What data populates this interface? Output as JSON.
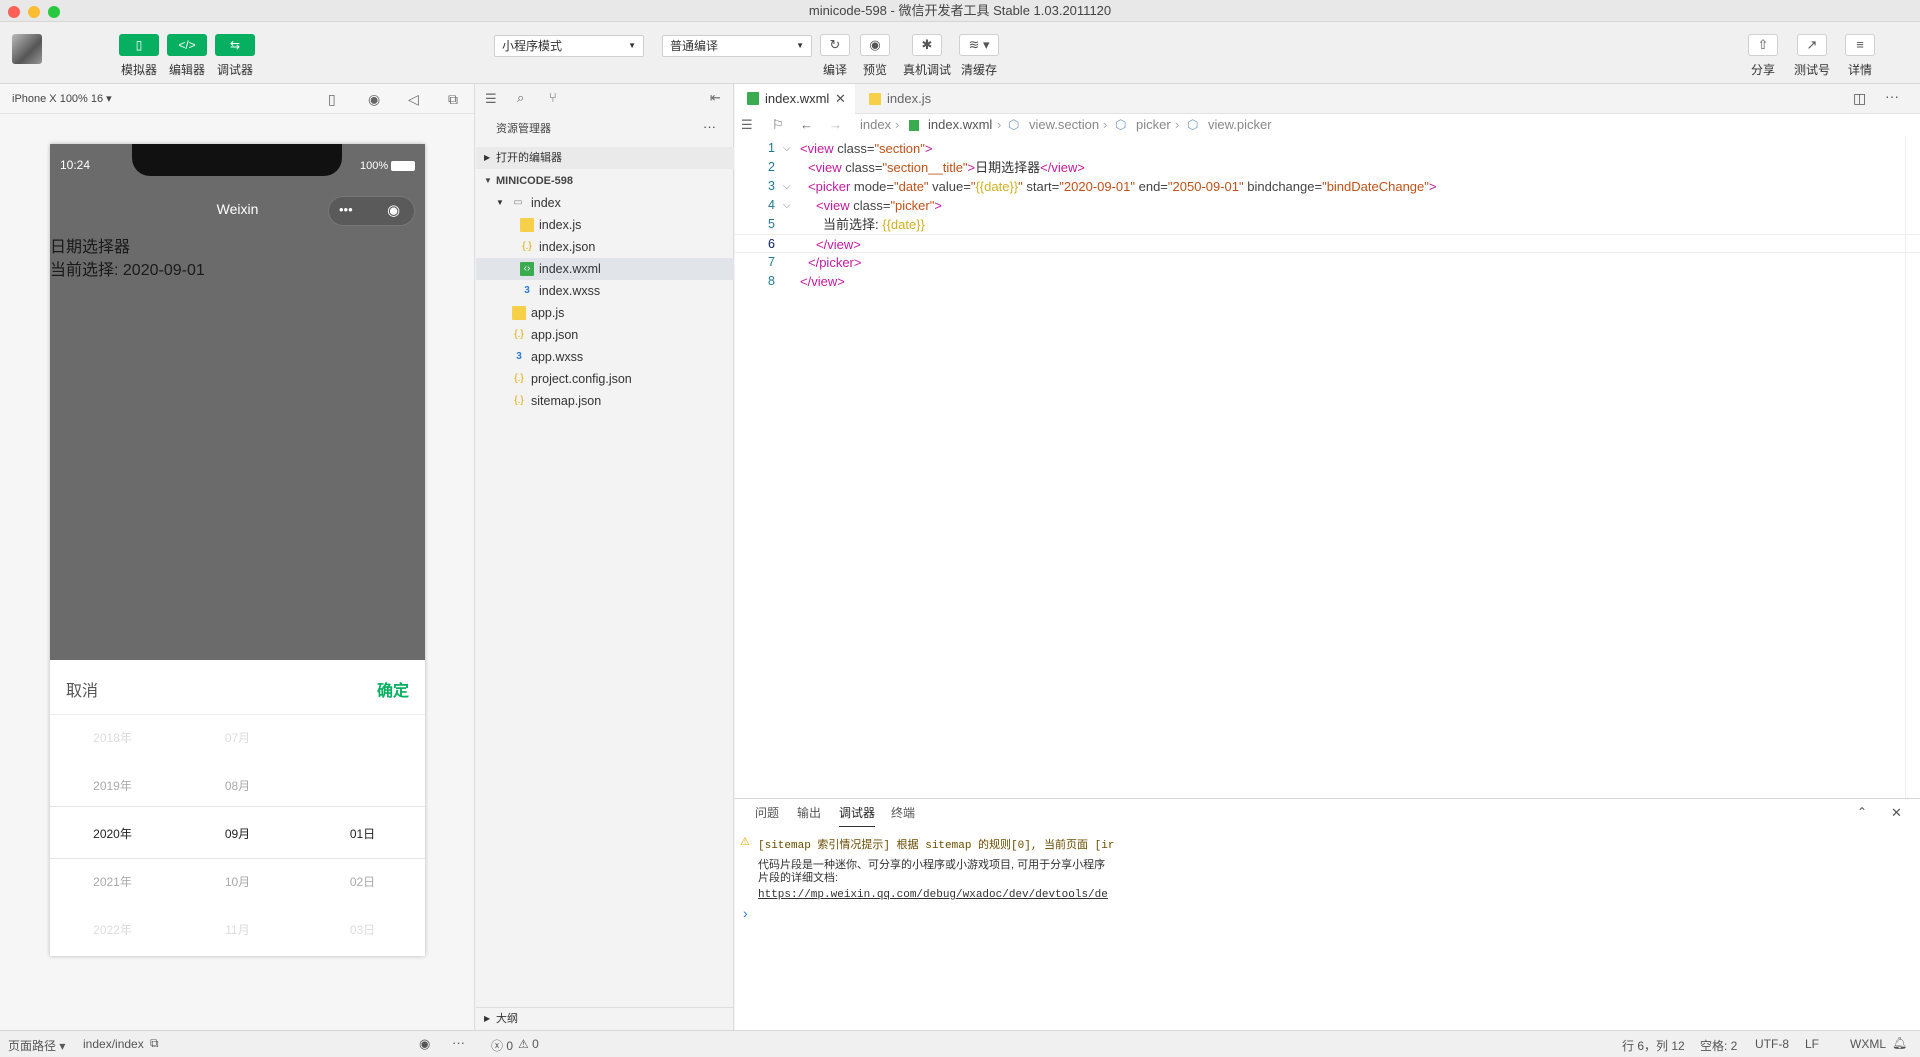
{
  "window": {
    "title": "minicode-598 - 微信开发者工具 Stable 1.03.2011120"
  },
  "toolbar": {
    "avatar_label": "avatar",
    "simulator": "模拟器",
    "editor": "编辑器",
    "debugger": "调试器",
    "mode_select": "小程序模式",
    "compile_select": "普通编译",
    "compile": "编译",
    "preview": "预览",
    "real_debug": "真机调试",
    "clear_cache": "清缓存",
    "share": "分享",
    "test_account": "测试号",
    "details": "详情"
  },
  "simulator": {
    "device": "iPhone X 100% 16 ▾",
    "time": "10:24",
    "battery": "100%",
    "nav_title": "Weixin",
    "page_title": "日期选择器",
    "current": "当前选择: 2020-09-01",
    "picker": {
      "cancel": "取消",
      "confirm": "确定",
      "years": [
        "2018年",
        "2019年",
        "2020年",
        "2021年",
        "2022年"
      ],
      "months": [
        "07月",
        "08月",
        "09月",
        "10月",
        "11月"
      ],
      "days": [
        "",
        "",
        "01日",
        "02日",
        "03日"
      ]
    }
  },
  "explorer": {
    "header": "资源管理器",
    "open_editors": "打开的编辑器",
    "project": "MINICODE-598",
    "folder_index": "index",
    "files_index": [
      "index.js",
      "index.json",
      "index.wxml",
      "index.wxss"
    ],
    "files_root": [
      "app.js",
      "app.json",
      "app.wxss",
      "project.config.json",
      "sitemap.json"
    ],
    "outline": "大纲"
  },
  "editor": {
    "tabs": [
      "index.wxml",
      "index.js"
    ],
    "crumbs": [
      "index",
      "index.wxml",
      "view.section",
      "picker",
      "view.picker"
    ],
    "line_numbers": [
      "1",
      "2",
      "3",
      "4",
      "5",
      "6",
      "7",
      "8"
    ],
    "code": {
      "l1": [
        "<view",
        " class=",
        "\"section\"",
        ">"
      ],
      "l2": [
        "<view",
        " class=",
        "\"section__title\"",
        ">",
        "日期选择器",
        "</view>"
      ],
      "l3": [
        "<picker",
        " mode=",
        "\"date\"",
        " value=",
        "\"",
        "{{date}}",
        "\"",
        " start=",
        "\"2020-09-01\"",
        " end=",
        "\"2050-09-01\"",
        " bindchange=",
        "\"bindDateChange\"",
        ">"
      ],
      "l4": [
        "<view",
        " class=",
        "\"picker\"",
        ">"
      ],
      "l5": [
        "当前选择: ",
        "{{date}}"
      ],
      "l6": [
        "</view>"
      ],
      "l7": [
        "</picker>"
      ],
      "l8": [
        "</view>"
      ]
    }
  },
  "console": {
    "tabs": [
      "问题",
      "输出",
      "调试器",
      "终端"
    ],
    "warn": "[sitemap 索引情况提示] 根据 sitemap 的规则[0], 当前页面 [ir",
    "info1": "代码片段是一种迷你、可分享的小程序或小游戏项目, 可用于分享小程序",
    "info2": "片段的详细文档:",
    "link": "https://mp.weixin.qq.com/debug/wxadoc/dev/devtools/de",
    "prompt": "›"
  },
  "status": {
    "page_path": "页面路径 ▾",
    "path": "index/index",
    "errors": "0",
    "warnings": "0",
    "position": "行 6，列 12",
    "spaces": "空格: 2",
    "encoding": "UTF-8",
    "eol": "LF",
    "lang": "WXML"
  },
  "colors": {
    "accent": "#07b061",
    "sim_bg": "#6b6b6b"
  }
}
